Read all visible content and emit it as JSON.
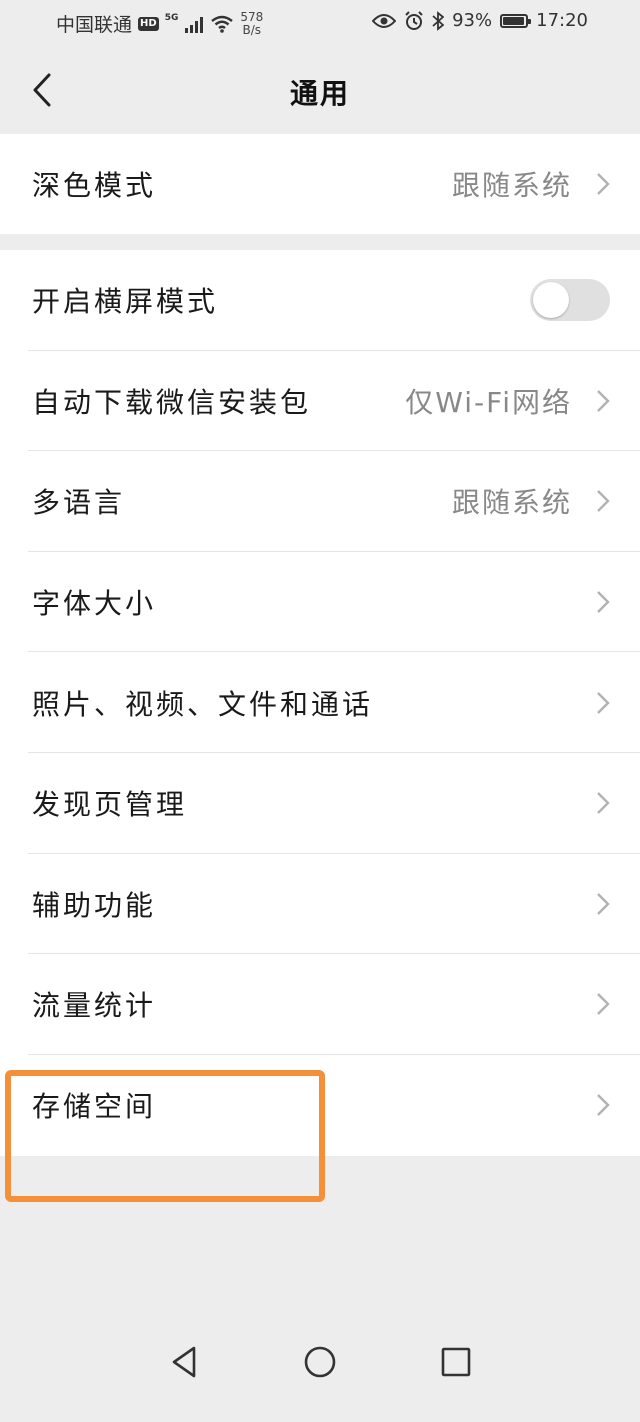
{
  "status_bar": {
    "carrier": "中国联通",
    "hd_badge": "HD",
    "network": "5G",
    "speed_value": "578",
    "speed_unit": "B/s",
    "battery": "93%",
    "battery_level": 0.93,
    "time": "17:20"
  },
  "header": {
    "title": "通用"
  },
  "group1": [
    {
      "label": "深色模式",
      "value": "跟随系统"
    }
  ],
  "group2": {
    "landscape": {
      "label": "开启横屏模式",
      "enabled": false
    },
    "items": [
      {
        "label": "自动下载微信安装包",
        "value": "仅Wi-Fi网络"
      },
      {
        "label": "多语言",
        "value": "跟随系统"
      },
      {
        "label": "字体大小",
        "value": ""
      },
      {
        "label": "照片、视频、文件和通话",
        "value": ""
      },
      {
        "label": "发现页管理",
        "value": ""
      },
      {
        "label": "辅助功能",
        "value": ""
      },
      {
        "label": "流量统计",
        "value": ""
      },
      {
        "label": "存储空间",
        "value": ""
      }
    ]
  },
  "colors": {
    "highlight": "#f5903a",
    "background": "#ededed",
    "value_text": "#888888"
  }
}
